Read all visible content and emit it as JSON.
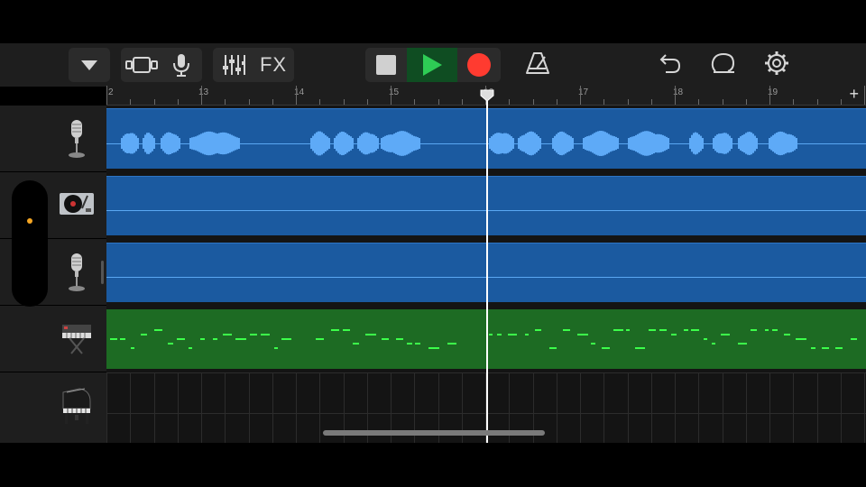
{
  "toolbar": {
    "fx_label": "FX",
    "icons": [
      "browser-toggle-icon",
      "track-view-icon",
      "microphone-icon",
      "mixer-icon",
      "fx",
      "stop-icon",
      "play-icon",
      "record-icon",
      "metronome-icon",
      "undo-icon",
      "loop-icon",
      "settings-icon"
    ]
  },
  "ruler": {
    "bars": [
      "2",
      "13",
      "14",
      "15",
      "16",
      "17",
      "18",
      "19"
    ],
    "add_label": "+"
  },
  "tracks": [
    {
      "instrument": "Audio Recorder (microphone)",
      "region": "audio",
      "color": "#1b5aa0"
    },
    {
      "instrument": "Live Loops / Turntable",
      "region": "empty-blue",
      "color": "#1b5aa0"
    },
    {
      "instrument": "Audio Recorder (microphone)",
      "region": "empty-blue",
      "color": "#1b5aa0"
    },
    {
      "instrument": "Keyboard Synth",
      "region": "midi",
      "color": "#1d6b23"
    },
    {
      "instrument": "Grand Piano",
      "region": "none",
      "color": "#1b1b1b"
    }
  ],
  "colors": {
    "accent_play": "#2ea54a",
    "record": "#ff3b30",
    "midi_notes": "#3cff4a",
    "audio_wave": "#5eaaf7",
    "status_dot": "#f5a623"
  }
}
